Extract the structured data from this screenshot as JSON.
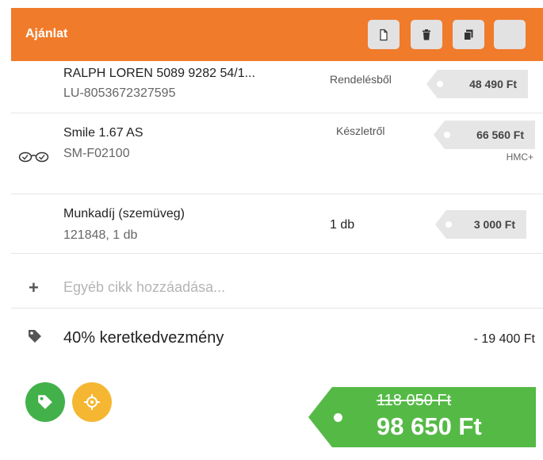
{
  "header": {
    "title": "Ajánlat",
    "buttons": [
      "new-document-icon",
      "trash-icon",
      "copy-icon",
      "blank"
    ]
  },
  "items": [
    {
      "name": "RALPH LOREN 5089 9282 54/1...",
      "code": "LU-8053672327595",
      "source": "Rendelésből",
      "price": "48 490 Ft"
    },
    {
      "name": "Smile 1.67 AS",
      "code": "SM-F02100",
      "source": "Készletről",
      "price": "66 560 Ft",
      "note": "HMC+",
      "icon": "glasses-icon"
    },
    {
      "name": "Munkadíj (szemüveg)",
      "code": "121848, 1 db",
      "qty": "1 db",
      "price": "3 000 Ft"
    }
  ],
  "add_item": {
    "placeholder": "Egyéb cikk hozzáadása..."
  },
  "discount": {
    "label": "40% keretkedvezmény",
    "value": "- 19 400 Ft"
  },
  "total": {
    "original": "118 050 Ft",
    "final": "98 650 Ft"
  },
  "colors": {
    "header": "#f07b2b",
    "tag": "#e6e6e6",
    "total": "#55b946",
    "green_button": "#43b149",
    "yellow_button": "#f5b731"
  }
}
